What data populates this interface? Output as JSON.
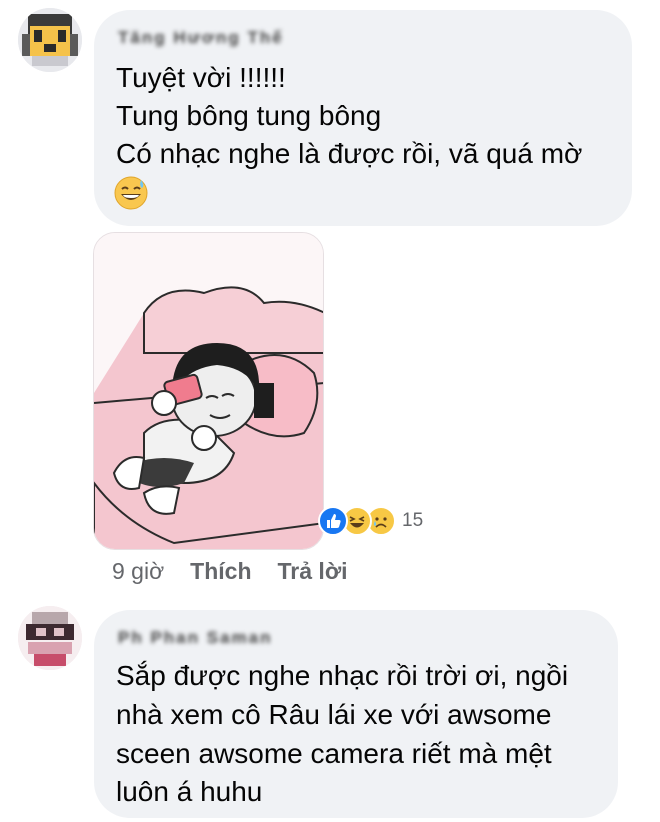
{
  "comments": [
    {
      "author": "Tăng Hương Thế",
      "lines": [
        "Tuyệt vời !!!!!!",
        "Tung bông tung bông",
        "Có nhạc nghe là được rồi, vã quá mờ"
      ],
      "emoji": "grinning-sweat-emoji",
      "attachment": "sticker-image",
      "reactions": {
        "icons": [
          "like-icon",
          "haha-icon",
          "sad-icon"
        ],
        "count": "15"
      },
      "time": "9 giờ",
      "actions": {
        "like": "Thích",
        "reply": "Trả lời"
      }
    },
    {
      "author": "Ph Phan Saman",
      "lines": [
        "Sắp được nghe nhạc rồi trời ơi, ngồi",
        "nhà xem cô Râu lái xe với awsome",
        "sceen awsome camera riết mà mệt",
        "luôn á huhu"
      ]
    }
  ],
  "colors": {
    "bubble": "#f0f2f5",
    "meta_text": "#65676b",
    "like_blue": "#1877f2",
    "haha_yellow": "#f7c845"
  }
}
